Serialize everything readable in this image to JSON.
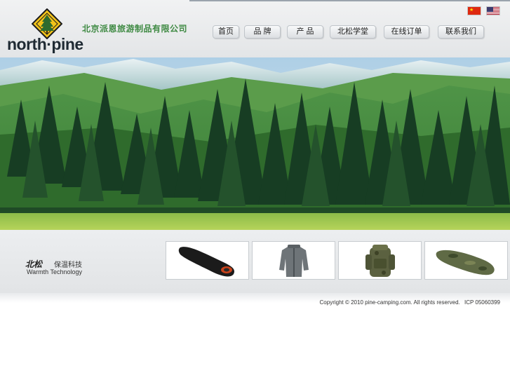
{
  "header": {
    "brand": "north·pine",
    "company_name": "北京派恩旅游制品有限公司",
    "languages": [
      {
        "name": "chinese",
        "icon": "cn-flag-icon"
      },
      {
        "name": "english",
        "icon": "us-flag-icon"
      }
    ]
  },
  "nav": {
    "items": [
      {
        "label": "首页"
      },
      {
        "label": "品 牌"
      },
      {
        "label": "产 品"
      },
      {
        "label": "北松学堂"
      },
      {
        "label": "在线订单"
      },
      {
        "label": "联系我们"
      }
    ]
  },
  "banner": {
    "icon": "forest-landscape-photo"
  },
  "products": {
    "brand_mark": "北松",
    "tagline_cn": "保温科技",
    "tagline_en": "Warmth Technology",
    "items": [
      {
        "icon": "black-sleeping-bag-icon"
      },
      {
        "icon": "grey-jacket-icon"
      },
      {
        "icon": "camo-backpack-icon"
      },
      {
        "icon": "camo-sleeping-bag-icon"
      }
    ]
  },
  "footer": {
    "copyright": "Copyright © 2010 pine-camping.com. All rights reserved.",
    "icp": "ICP 05060399"
  },
  "colors": {
    "company_name_green": "#3f8a43",
    "logo_yellow": "#f2c319",
    "forest_dark": "#173d23",
    "header_bg": "#e6e8ea"
  }
}
